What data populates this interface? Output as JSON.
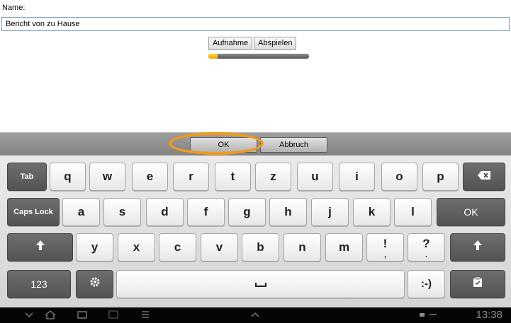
{
  "form": {
    "name_label": "Name:",
    "name_value": "Bericht von zu Hause",
    "record_label": "Aufnahme",
    "play_label": "Abspielen",
    "progress_fraction": 0.09
  },
  "dialog": {
    "ok_label": "OK",
    "cancel_label": "Abbruch"
  },
  "keyboard": {
    "row1": [
      "q",
      "w",
      "e",
      "r",
      "t",
      "z",
      "u",
      "i",
      "o",
      "p"
    ],
    "row2": [
      "a",
      "s",
      "d",
      "f",
      "g",
      "h",
      "j",
      "k",
      "l"
    ],
    "row3": [
      "y",
      "x",
      "c",
      "v",
      "b",
      "n",
      "m",
      "!",
      "?"
    ],
    "row3_sub": {
      "excl": ",",
      "quest": "."
    },
    "tab_label": "Tab",
    "capslock_label": "Caps Lock",
    "ok_label": "OK",
    "numbers_label": "123",
    "smiley_label": ":-)",
    "backspace_icon": "backspace-icon",
    "shift_icon": "shift-arrow-icon",
    "settings_icon": "gear-icon",
    "space_icon": "space-bar-icon",
    "clipboard_icon": "clipboard-icon"
  },
  "system_bar": {
    "clock": "13:38",
    "icons": [
      "chevron-down-icon",
      "home-icon",
      "recent-apps-icon",
      "screenshot-icon",
      "menu-icon",
      "chevron-up-icon"
    ]
  },
  "colors": {
    "highlight": "#f19a1c",
    "progress": "#f1a400"
  }
}
